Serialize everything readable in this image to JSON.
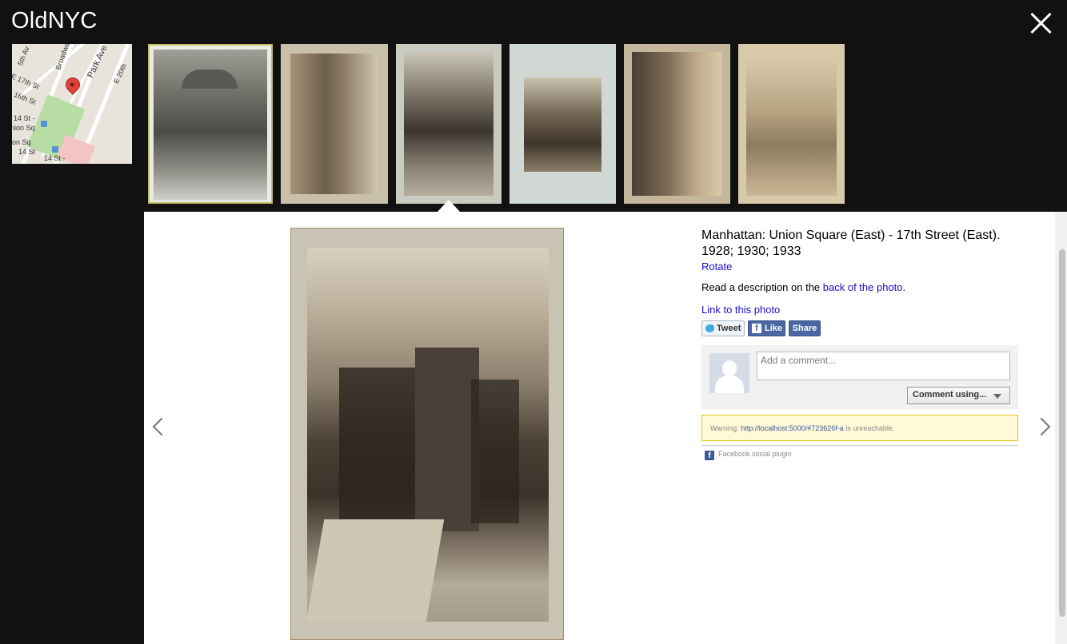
{
  "app": {
    "title": "OldNYC",
    "close_label": "close"
  },
  "map": {
    "labels": [
      "5th Av",
      "Broadway",
      "Park Ave",
      "E 20th",
      "E 17th St",
      "16th St",
      "14 St -",
      "nion Sq",
      "ion Sq",
      "14 St",
      "14 St -"
    ]
  },
  "photo": {
    "title": "Manhattan: Union Square (East) - 17th Street (East). 1928; 1930; 1933",
    "rotate_label": "Rotate",
    "desc_prefix": "Read a description on the",
    "desc_link": "back of the photo",
    "desc_suffix": ".",
    "permalink_label": "Link to this photo"
  },
  "social": {
    "tweet": "Tweet",
    "like": "Like",
    "share": "Share",
    "fb_glyph": "f"
  },
  "comments": {
    "placeholder": "Add a comment...",
    "using_label": "Comment using...",
    "warning_prefix": "Warning:",
    "warning_url": "http://localhost:5000/#723626f-a",
    "warning_suffix": "is unreachable.",
    "plugin_label": "Facebook social plugin"
  },
  "colors": {
    "background": "#111111",
    "panel": "#ffffff",
    "link": "#1a0dcc",
    "facebook": "#4a66a4",
    "warning_bg": "#fff9d7"
  }
}
